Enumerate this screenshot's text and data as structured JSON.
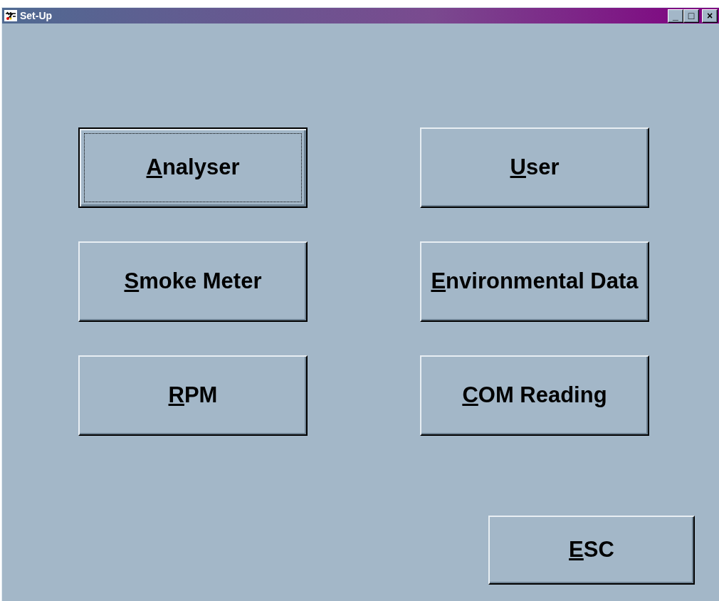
{
  "window": {
    "title": "Set-Up",
    "controls": [
      "_",
      "□",
      "×"
    ]
  },
  "buttons": [
    {
      "label": "Analyser",
      "mnemonic": true,
      "focused": true
    },
    {
      "label": "User",
      "mnemonic": true,
      "focused": false
    },
    {
      "label": "Smoke Meter",
      "mnemonic": true,
      "focused": false
    },
    {
      "label": "Environmental Data",
      "mnemonic": true,
      "focused": false
    },
    {
      "label": "RPM",
      "mnemonic": true,
      "focused": false
    },
    {
      "label": "COM Reading",
      "mnemonic": true,
      "focused": false
    }
  ],
  "esc_button": {
    "label": "ESC",
    "mnemonic": true,
    "focused": false
  }
}
